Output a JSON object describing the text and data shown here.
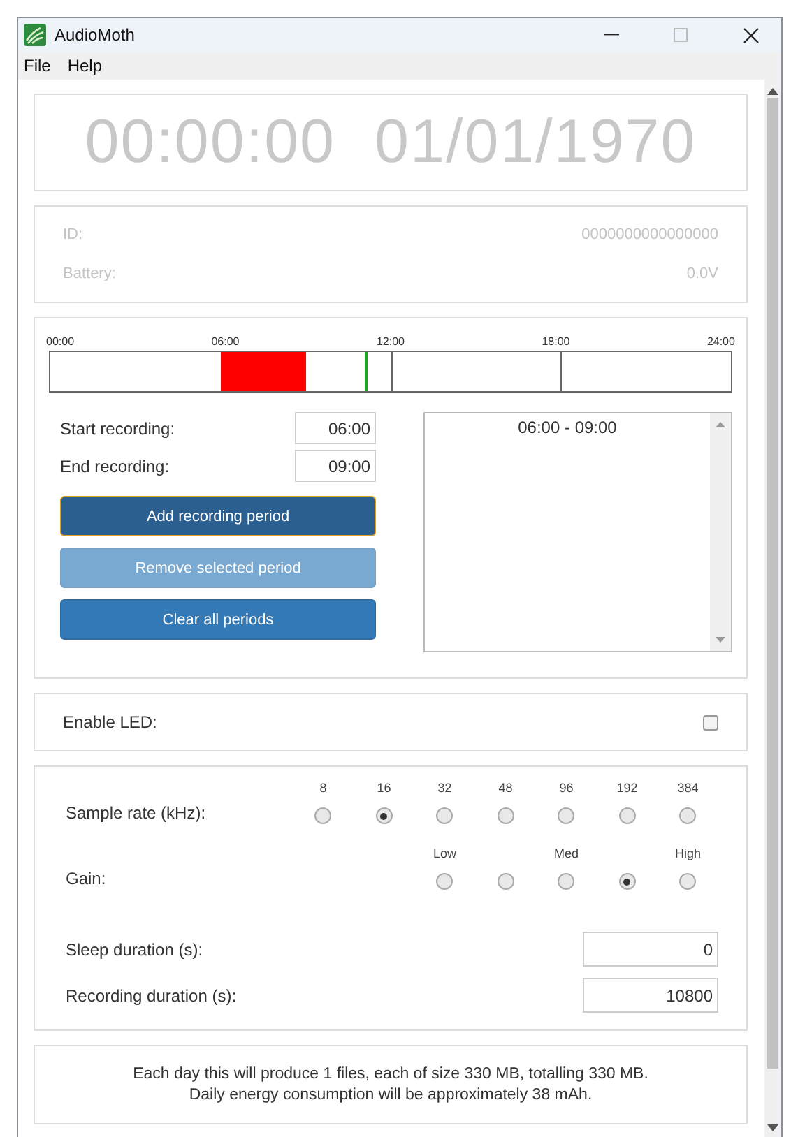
{
  "window": {
    "title": "AudioMoth"
  },
  "menu": [
    "File",
    "Help"
  ],
  "clock": {
    "time": "00:00:00",
    "date": "01/01/1970"
  },
  "device": [
    {
      "label": "ID:",
      "value": "0000000000000000"
    },
    {
      "label": "Battery:",
      "value": "0.0V"
    }
  ],
  "timeline": {
    "ticks": [
      "00:00",
      "06:00",
      "12:00",
      "18:00",
      "24:00"
    ],
    "now_marker": {
      "level": 0.4625
    }
  },
  "schedule": {
    "fields": [
      {
        "label": "Start recording:",
        "value": "06:00"
      },
      {
        "label": "End recording:",
        "value": "09:00"
      }
    ],
    "buttons": [
      {
        "kind": "primary",
        "label": "Add recording period",
        "focused": true,
        "disabled": false
      },
      {
        "kind": "secondary",
        "label": "Remove selected period",
        "focused": false,
        "disabled": true
      },
      {
        "kind": "secondary",
        "label": "Clear all periods",
        "focused": false,
        "disabled": false
      }
    ],
    "periods": [
      {
        "label": "06:00 - 09:00",
        "selected": false
      }
    ]
  },
  "led": {
    "label": "Enable LED:",
    "checked": false
  },
  "sample_rate": {
    "label": "Sample rate (kHz):",
    "options": [
      {
        "label": "8",
        "selected": false
      },
      {
        "label": "16",
        "selected": true
      },
      {
        "label": "32",
        "selected": false
      },
      {
        "label": "48",
        "selected": false
      },
      {
        "label": "96",
        "selected": false
      },
      {
        "label": "192",
        "selected": false
      },
      {
        "label": "384",
        "selected": false
      }
    ]
  },
  "gain": {
    "label": "Gain:",
    "options": [
      {
        "label": "Low",
        "selected": false
      },
      {
        "selected": false
      },
      {
        "label": "Med",
        "selected": false
      },
      {
        "selected": true
      },
      {
        "label": "High",
        "selected": false
      }
    ]
  },
  "durations": [
    {
      "label": "Sleep duration (s):",
      "value": "0"
    },
    {
      "label": "Recording duration (s):",
      "value": "10800"
    }
  ],
  "summary": [
    "Each day this will produce 1 files, each of size 330 MB, totalling 330 MB.",
    "Daily energy consumption will be approximately 38 mAh."
  ]
}
